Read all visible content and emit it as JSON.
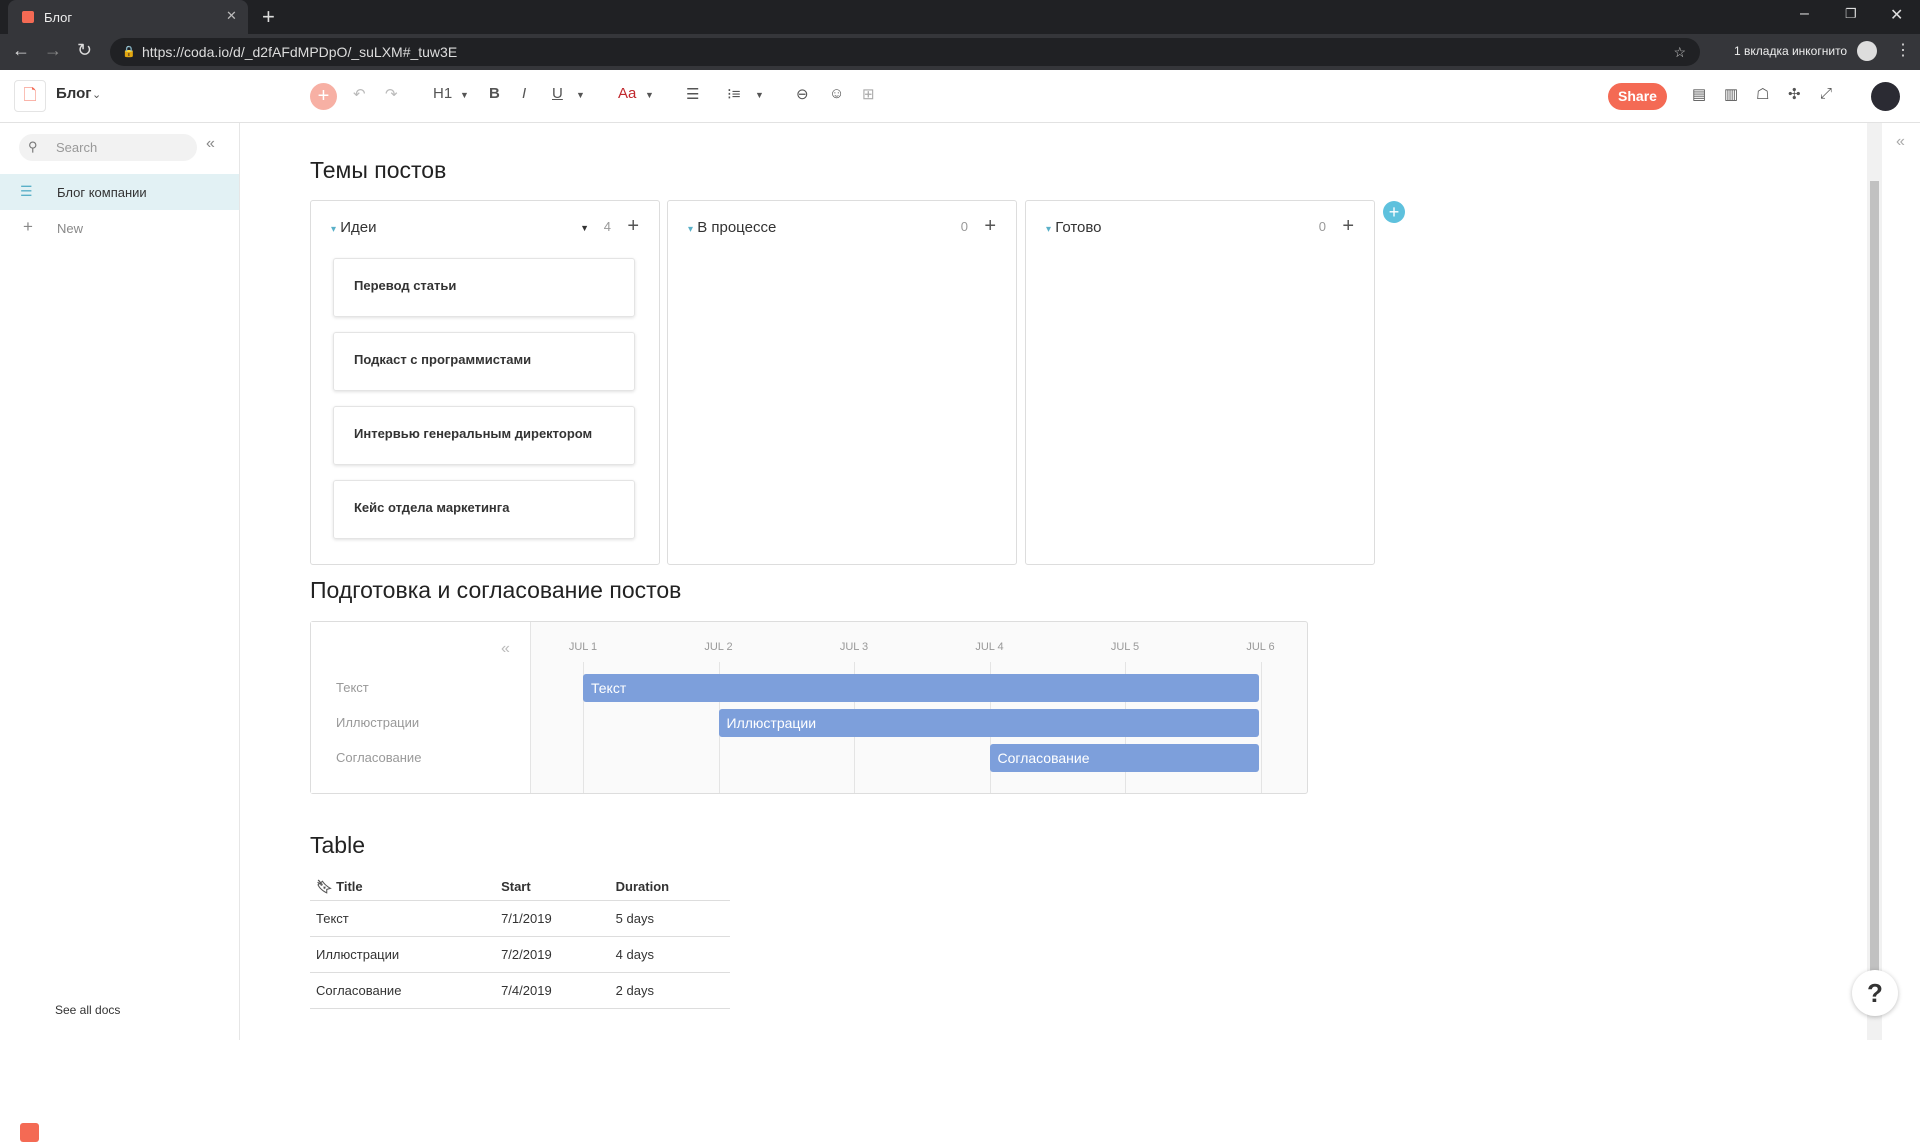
{
  "browser": {
    "tab_title": "Блог",
    "url": "https://coda.io/d/_d2fAFdMPDpO/_suLXM#_tuw3E",
    "incognito": "1 вкладка инкогнито"
  },
  "toolbar": {
    "doc_title": "Блог",
    "heading": "H1",
    "bold": "B",
    "italic": "I",
    "underline": "U",
    "font_color": "Aa",
    "share": "Share"
  },
  "sidebar": {
    "search_placeholder": "Search",
    "items": [
      {
        "label": "Блог компании"
      }
    ],
    "new": "New",
    "see_all": "See all docs"
  },
  "kanban": {
    "title": "Темы постов",
    "columns": [
      {
        "label": "Идеи",
        "count": "4",
        "cards": [
          "Перевод статьи",
          "Подкаст с программистами",
          "Интервью генеральным директором",
          "Кейс отдела маркетинга"
        ]
      },
      {
        "label": "В процессе",
        "count": "0",
        "cards": []
      },
      {
        "label": "Готово",
        "count": "0",
        "cards": []
      }
    ]
  },
  "gantt": {
    "title": "Подготовка и согласование постов",
    "dates": [
      "JUL 1",
      "JUL 2",
      "JUL 3",
      "JUL 4",
      "JUL 5",
      "JUL 6"
    ],
    "rows": [
      {
        "label": "Текст",
        "start": 0,
        "end": 5
      },
      {
        "label": "Иллюстрации",
        "start": 1,
        "end": 5
      },
      {
        "label": "Согласование",
        "start": 3,
        "end": 5
      }
    ]
  },
  "table": {
    "title": "Table",
    "headers": [
      "Title",
      "Start",
      "Duration"
    ],
    "rows": [
      [
        "Текст",
        "7/1/2019",
        "5 days"
      ],
      [
        "Иллюстрации",
        "7/2/2019",
        "4 days"
      ],
      [
        "Согласование",
        "7/4/2019",
        "2 days"
      ]
    ]
  },
  "help": "?"
}
